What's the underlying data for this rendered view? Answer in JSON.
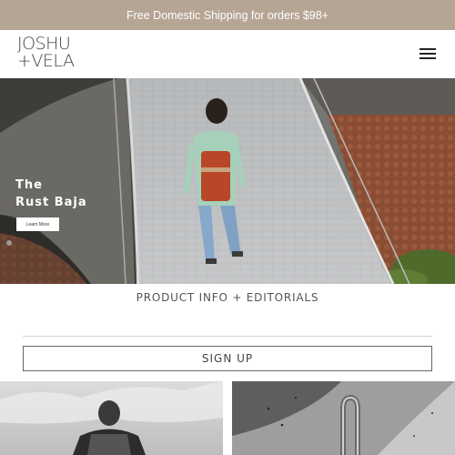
{
  "promo": {
    "text": "Free Domestic Shipping for orders $98+"
  },
  "header": {
    "logo_line1": "JOSHU",
    "logo_line2": "+VELA",
    "menu_icon": "hamburger-menu-icon"
  },
  "hero": {
    "title_line1": "The",
    "title_line2": "Rust Baja",
    "cta_label": "Learn More"
  },
  "info_link": {
    "label": "PRODUCT INFO + EDITORIALS"
  },
  "signup": {
    "label": "SIGN UP"
  },
  "colors": {
    "promo_bg": "#b5a594",
    "text": "#333333"
  }
}
